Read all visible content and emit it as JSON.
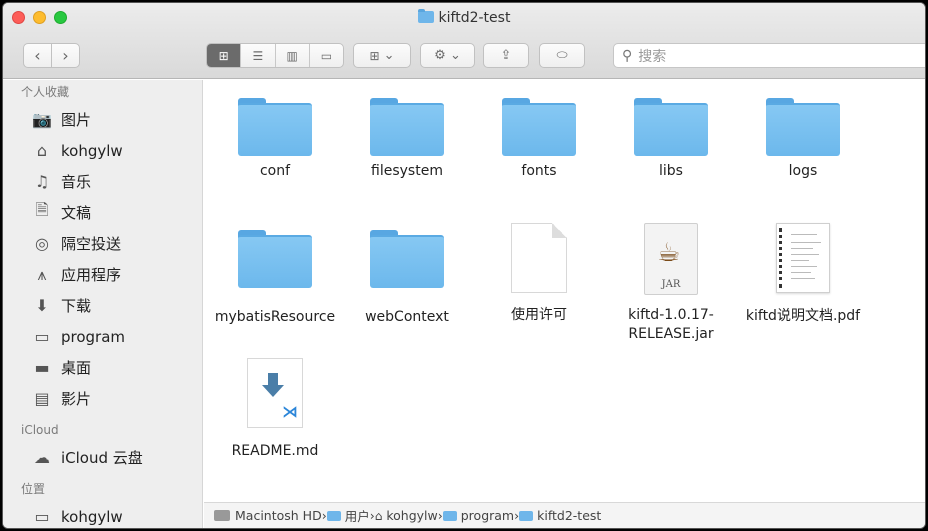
{
  "window": {
    "title": "kiftd2-test"
  },
  "toolbar": {
    "back_icon": "chevron-left-icon",
    "forward_icon": "chevron-right-icon",
    "search_placeholder": "搜索"
  },
  "sidebar": {
    "sections": [
      {
        "title": "个人收藏",
        "items": [
          {
            "label": "图片",
            "icon": "camera-icon"
          },
          {
            "label": "kohgylw",
            "icon": "home-icon"
          },
          {
            "label": "音乐",
            "icon": "music-note-icon"
          },
          {
            "label": "文稿",
            "icon": "documents-icon"
          },
          {
            "label": "隔空投送",
            "icon": "airdrop-icon"
          },
          {
            "label": "应用程序",
            "icon": "applications-icon"
          },
          {
            "label": "下载",
            "icon": "download-icon"
          },
          {
            "label": "program",
            "icon": "folder-icon"
          },
          {
            "label": "桌面",
            "icon": "desktop-icon"
          },
          {
            "label": "影片",
            "icon": "film-icon"
          }
        ]
      },
      {
        "title": "iCloud",
        "items": [
          {
            "label": "iCloud 云盘",
            "icon": "cloud-icon"
          }
        ]
      },
      {
        "title": "位置",
        "items": [
          {
            "label": "kohgylw",
            "icon": "computer-icon"
          }
        ]
      }
    ]
  },
  "files": [
    {
      "name": "conf",
      "kind": "folder"
    },
    {
      "name": "filesystem",
      "kind": "folder"
    },
    {
      "name": "fonts",
      "kind": "folder"
    },
    {
      "name": "libs",
      "kind": "folder"
    },
    {
      "name": "logs",
      "kind": "folder"
    },
    {
      "name": "mybatisResource",
      "kind": "folder"
    },
    {
      "name": "webContext",
      "kind": "folder"
    },
    {
      "name": "使用许可",
      "kind": "document"
    },
    {
      "name": "kiftd-1.0.17-\nRELEASE.jar",
      "kind": "jar",
      "badge": "JAR"
    },
    {
      "name": "kiftd说明文档.pdf",
      "kind": "pdf"
    },
    {
      "name": "README.md",
      "kind": "markdown"
    }
  ],
  "pathbar": {
    "crumbs": [
      "Macintosh HD",
      "用户",
      "kohgylw",
      "program",
      "kiftd2-test"
    ]
  }
}
